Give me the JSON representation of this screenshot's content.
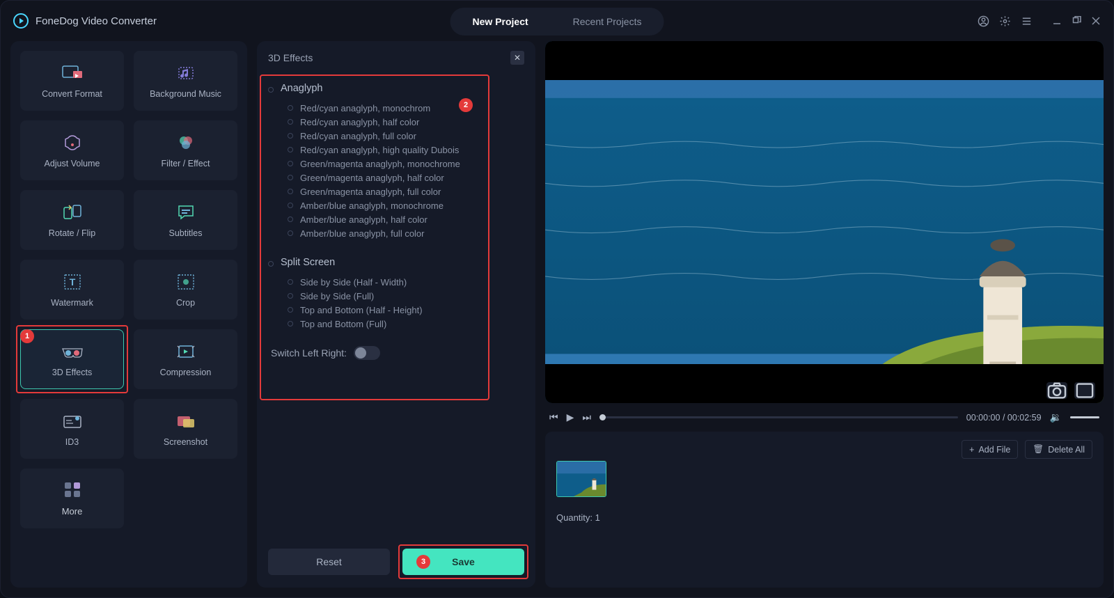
{
  "app_title": "FoneDog Video Converter",
  "tabs": {
    "new": "New Project",
    "recent": "Recent Projects"
  },
  "tools": [
    {
      "label": "Convert Format"
    },
    {
      "label": "Background Music"
    },
    {
      "label": "Adjust Volume"
    },
    {
      "label": "Filter / Effect"
    },
    {
      "label": "Rotate / Flip"
    },
    {
      "label": "Subtitles"
    },
    {
      "label": "Watermark"
    },
    {
      "label": "Crop"
    },
    {
      "label": "3D Effects"
    },
    {
      "label": "Compression"
    },
    {
      "label": "ID3"
    },
    {
      "label": "Screenshot"
    }
  ],
  "more_label": "More",
  "active_tool_index": 8,
  "center": {
    "title": "3D Effects",
    "anaglyph_title": "Anaglyph",
    "anaglyph_options": [
      "Red/cyan anaglyph, monochrom",
      "Red/cyan anaglyph, half color",
      "Red/cyan anaglyph, full color",
      "Red/cyan anaglyph, high quality Dubois",
      "Green/magenta anaglyph, monochrome",
      "Green/magenta anaglyph, half color",
      "Green/magenta anaglyph, full color",
      "Amber/blue anaglyph, monochrome",
      "Amber/blue anaglyph, half color",
      "Amber/blue anaglyph, full color"
    ],
    "split_title": "Split Screen",
    "split_options": [
      "Side by Side (Half - Width)",
      "Side by Side (Full)",
      "Top and Bottom (Half - Height)",
      "Top and Bottom (Full)"
    ],
    "switch_label": "Switch Left Right:",
    "reset": "Reset",
    "save": "Save"
  },
  "player": {
    "time_current": "00:00:00",
    "time_total": "00:02:59"
  },
  "files": {
    "add_file": "Add File",
    "delete_all": "Delete All",
    "quantity_label": "Quantity: 1"
  },
  "callouts": {
    "one": "1",
    "two": "2",
    "three": "3"
  },
  "colors": {
    "accent": "#3ec9b0",
    "save_btn": "#44e5c0",
    "highlight": "#e43a3a"
  }
}
